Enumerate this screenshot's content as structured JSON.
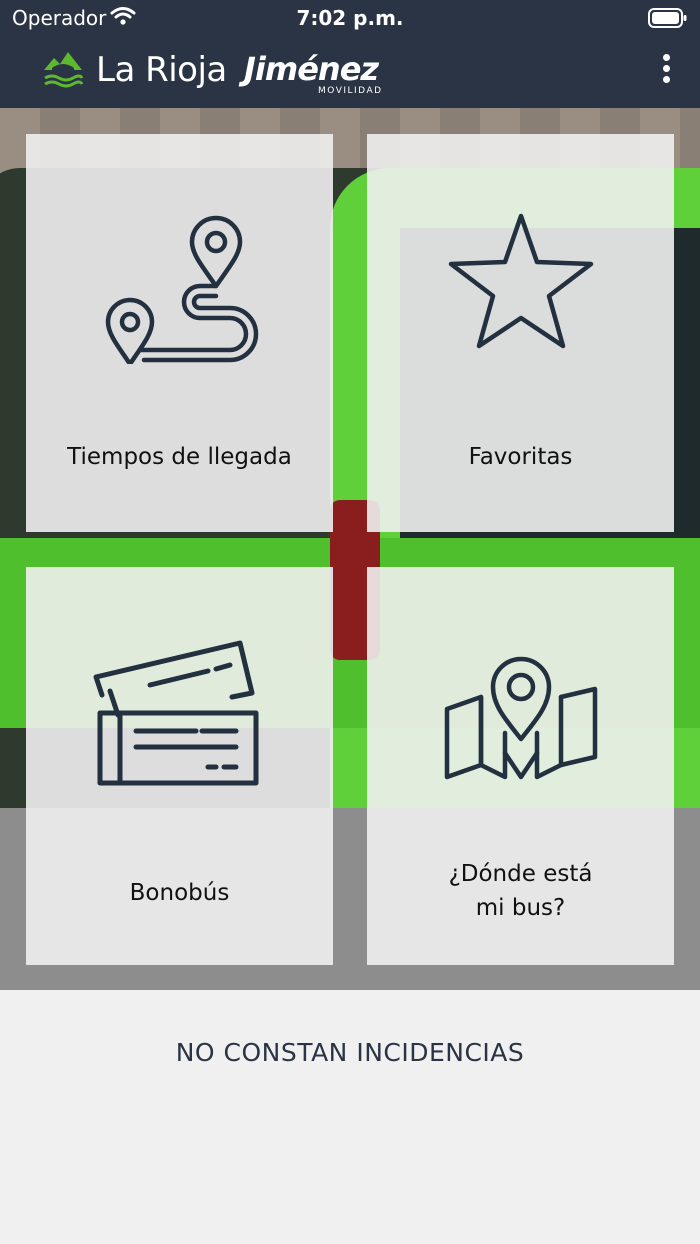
{
  "status_bar": {
    "carrier": "Operador",
    "time": "7:02 p.m."
  },
  "header": {
    "logo_left": "La Rioja",
    "logo_right": "Jiménez",
    "logo_right_sub": "MOVILIDAD",
    "menu_icon": "more-vertical-icon"
  },
  "tiles": [
    {
      "id": "tiempos",
      "label": "Tiempos de llegada",
      "icon": "route-icon"
    },
    {
      "id": "favoritas",
      "label": "Favoritas",
      "icon": "star-icon"
    },
    {
      "id": "bonobus",
      "label": "Bonobús",
      "icon": "ticket-icon"
    },
    {
      "id": "donde",
      "label_line1": "¿Dónde está",
      "label_line2": "mi bus?",
      "icon": "map-pin-icon"
    }
  ],
  "incidents": {
    "text": "NO CONSTAN INCIDENCIAS"
  },
  "colors": {
    "header_bg": "#2a3444",
    "icon_stroke": "#22303f",
    "brand_green": "#5cb82e"
  }
}
